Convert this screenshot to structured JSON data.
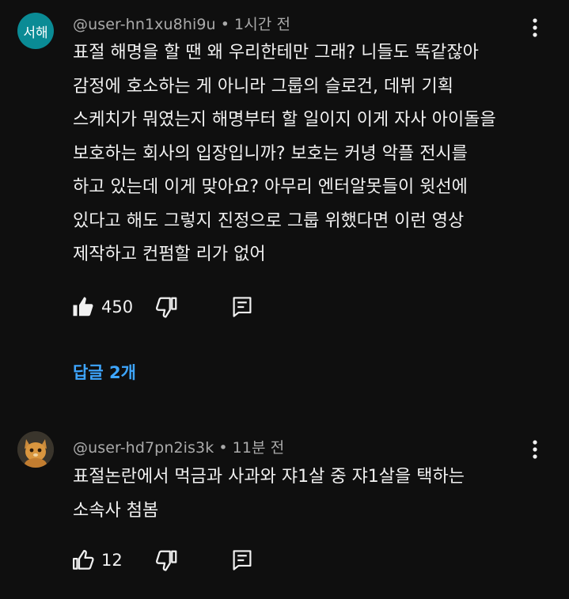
{
  "comments": [
    {
      "avatar_text": "서해",
      "avatar_color": "#0a8b95",
      "username": "@user-hn1xu8hi9u",
      "separator": "•",
      "time": "1시간 전",
      "lines": [
        "표절 해명을 할 땐 왜 우리한테만 그래? 니들도 똑같잖아",
        "감정에 호소하는 게 아니라 그룹의 슬로건, 데뷔 기획",
        "스케치가 뭐였는지 해명부터 할 일이지 이게 자사 아이돌을",
        "보호하는 회사의 입장입니까? 보호는 커녕 악플 전시를",
        "하고 있는데 이게 맞아요?  아무리 엔터알못들이 윗선에",
        "있다고 해도 그렇지 진정으로 그룹 위했다면 이런 영상",
        "제작하고 컨펌할 리가 없어"
      ],
      "likes": "450",
      "liked_icon": "thumbs-up-filled",
      "replies_label": "답글 2개"
    },
    {
      "avatar_icon": "cat-photo",
      "username": "@user-hd7pn2is3k",
      "separator": "•",
      "time": "11분 전",
      "lines": [
        "표절논란에서 먹금과 사과와 쟈1살 중 쟈1살을 택하는",
        "소속사 첨봄"
      ],
      "likes": "12",
      "liked_icon": "thumbs-up-outline"
    }
  ],
  "colors": {
    "background": "#0f0f0f",
    "text": "#f1f1f1",
    "meta": "#aaaaaa",
    "link": "#3ea6ff"
  }
}
